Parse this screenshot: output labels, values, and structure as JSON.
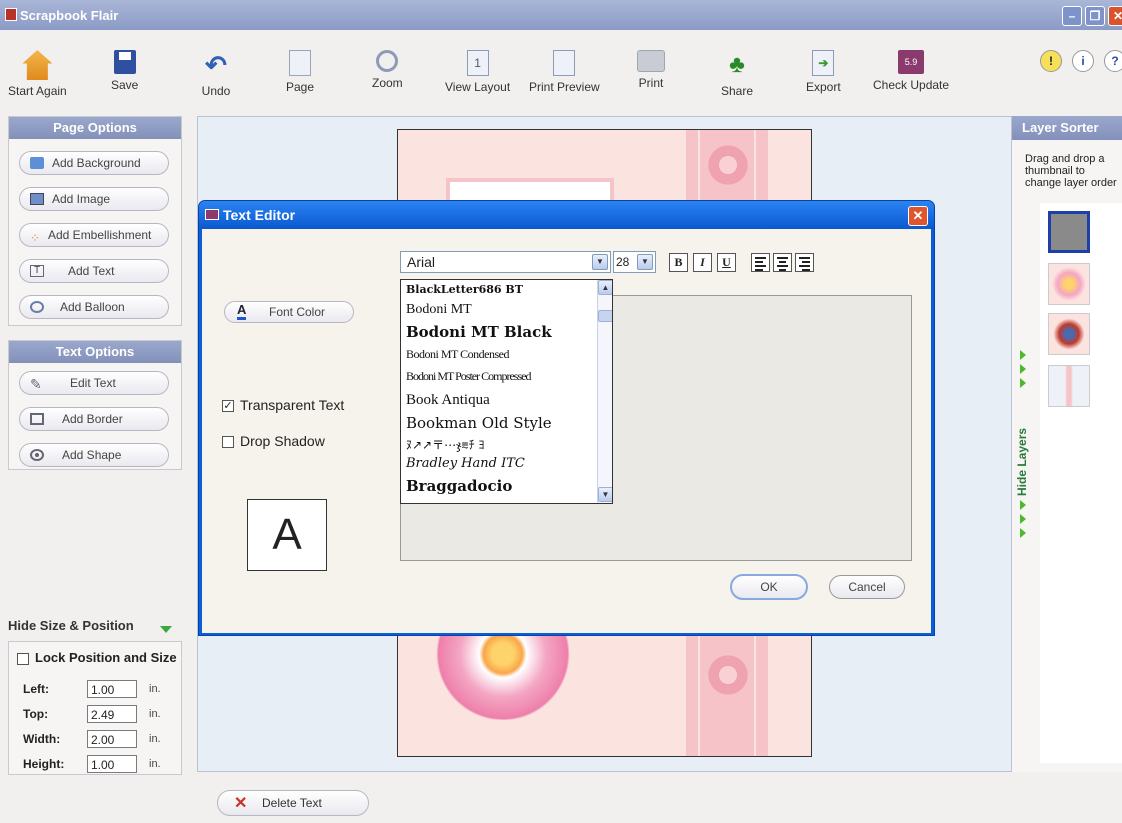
{
  "window": {
    "title": "Scrapbook Flair"
  },
  "toolbar": {
    "items": [
      {
        "label": "Start Again",
        "icon": "house-icon"
      },
      {
        "label": "Save",
        "icon": "floppy-disk-icon"
      },
      {
        "label": "Undo",
        "icon": "undo-arrow-icon"
      },
      {
        "label": "Page",
        "icon": "page-icon"
      },
      {
        "label": "Zoom",
        "icon": "magnifier-icon"
      },
      {
        "label": "View Layout",
        "icon": "layout-icon"
      },
      {
        "label": "Print Preview",
        "icon": "print-preview-icon"
      },
      {
        "label": "Print",
        "icon": "printer-icon"
      },
      {
        "label": "Share",
        "icon": "people-icon"
      },
      {
        "label": "Export",
        "icon": "export-icon"
      },
      {
        "label": "Check Update",
        "icon": "update-icon"
      }
    ]
  },
  "page_options": {
    "title": "Page Options",
    "buttons": [
      "Add Background",
      "Add Image",
      "Add Embellishment",
      "Add Text",
      "Add Balloon"
    ]
  },
  "text_options": {
    "title": "Text Options",
    "buttons": [
      "Edit Text",
      "Add Border",
      "Add Shape"
    ]
  },
  "size_position": {
    "header": "Hide Size & Position",
    "lock_label": "Lock Position and Size",
    "rows": [
      {
        "label": "Left:",
        "value": "1.00",
        "unit": "in."
      },
      {
        "label": "Top:",
        "value": "2.49",
        "unit": "in."
      },
      {
        "label": "Width:",
        "value": "2.00",
        "unit": "in."
      },
      {
        "label": "Height:",
        "value": "1.00",
        "unit": "in."
      }
    ]
  },
  "delete_button": "Delete Text",
  "layer_sorter": {
    "title": "Layer Sorter",
    "description": "Drag and drop a thumbnail to change layer order",
    "hide_label": "Hide Layers"
  },
  "dialog": {
    "title": "Text Editor",
    "font": "Arial",
    "size": "28",
    "bold": "B",
    "italic": "I",
    "underline": "U",
    "font_color_label": "Font Color",
    "font_color_glyph": "A",
    "transparent_text": "Transparent Text",
    "drop_shadow": "Drop Shadow",
    "preview_glyph": "A",
    "ok": "OK",
    "cancel": "Cancel",
    "font_list": [
      "BlackLetter686 BT",
      "Bodoni MT",
      "Bodoni MT Black",
      "Bodoni MT Condensed",
      "Bodoni MT Poster Compressed",
      "Book Antiqua",
      "Bookman Old Style",
      "ﾇ↗↗〒⋯ჯ⩳ﾁ ﾖ",
      "Bradley Hand ITC",
      "Braggadocio"
    ]
  }
}
